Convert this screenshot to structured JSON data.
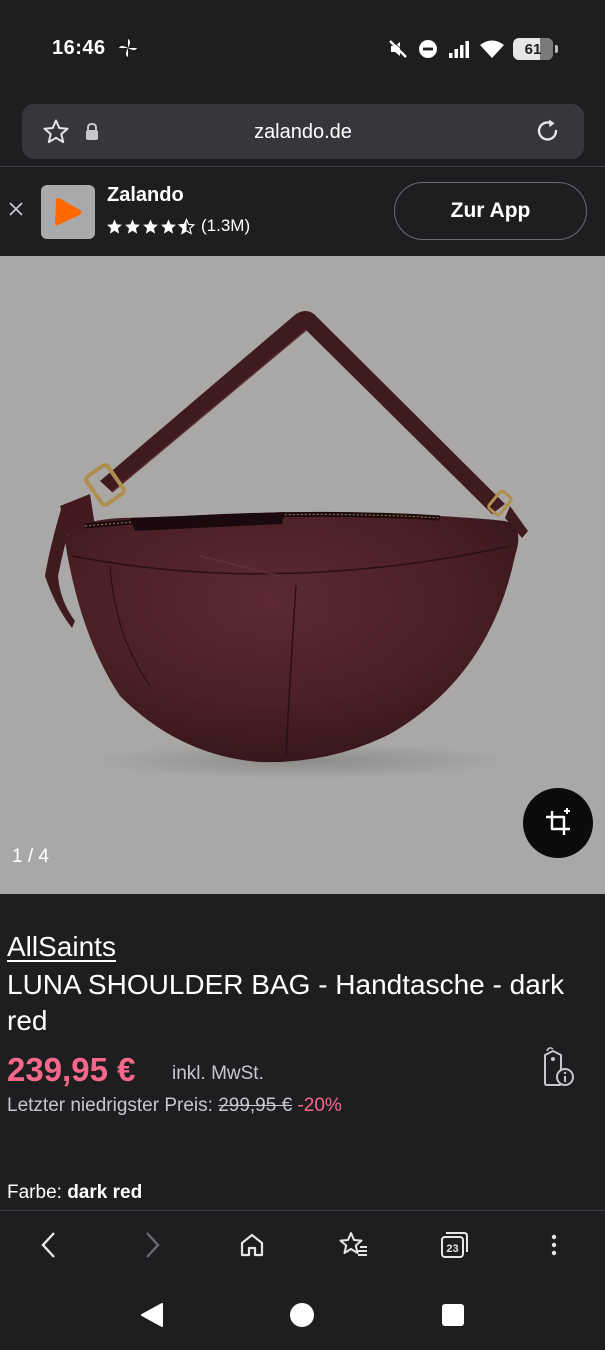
{
  "status_bar": {
    "time": "16:46",
    "battery": "61",
    "icons": [
      "pinwheel-icon",
      "mute-icon",
      "do-not-disturb-icon",
      "signal-icon",
      "wifi-icon",
      "battery-icon"
    ]
  },
  "address_bar": {
    "url": "zalando.de",
    "icons": [
      "star-outline-icon",
      "lock-icon",
      "reload-icon"
    ]
  },
  "app_banner": {
    "app_name": "Zalando",
    "rating_count": "(1.3M)",
    "stars": 4.5,
    "cta_label": "Zur App"
  },
  "gallery": {
    "counter": "1 / 4",
    "ar_icon": "ar-view-icon"
  },
  "product": {
    "brand": "AllSaints",
    "name": "LUNA SHOULDER BAG - Handtasche - dark red",
    "price": "239,95 €",
    "vat_note": "inkl. MwSt.",
    "lowest_label": "Letzter niedrigster Preis:",
    "lowest_price": "299,95 €",
    "discount": "-20%",
    "color_label": "Farbe:",
    "color_value": "dark red",
    "price_color": "#f6688a"
  },
  "toolbar": {
    "tab_count": "23",
    "icons": [
      "back-icon",
      "forward-icon",
      "home-icon",
      "bookmarks-icon",
      "tabs-icon",
      "more-icon"
    ]
  },
  "navbar": {
    "icons": [
      "nav-back-icon",
      "nav-home-icon",
      "nav-recents-icon"
    ]
  }
}
